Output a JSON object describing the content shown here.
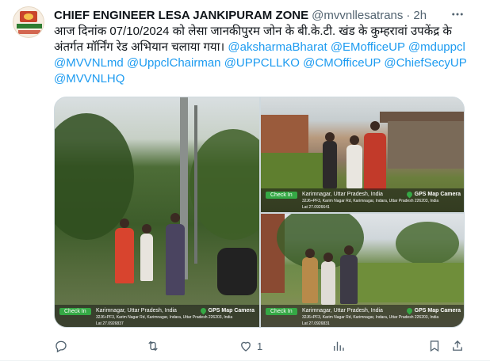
{
  "author": {
    "name": "CHIEF ENGINEER LESA JANKIPURAM ZONE",
    "handle": "@mvvnllesatrans",
    "time": "2h"
  },
  "tweet": {
    "text_hindi": "आज दिनांक 07/10/2024 को लेसा जानकीपुरम जोन के बी.के.टी. खंड के कुम्हरावां उपकेंद्र के अंतर्गत मॉर्निंग रेड अभियान चलाया गया।",
    "mentions": [
      "@aksharmaBharat",
      "@EMofficeUP",
      "@mduppcl",
      "@MVVNLmd",
      "@UppclChairman",
      "@UPPCLLKO",
      "@CMOfficeUP",
      "@ChiefSecyUP",
      "@MVVNLHQ"
    ]
  },
  "photos": [
    {
      "checkin": "Check In",
      "camera": "GPS Map Camera",
      "location": "Karimnagar, Uttar Pradesh, India",
      "address": "32J6+PF3, Karim Nagar Rd, Karimnagar, Indara, Uttar Pradesh 226203, India",
      "lat": "Lat 27.0926837"
    },
    {
      "checkin": "Check In",
      "camera": "GPS Map Camera",
      "location": "Karimnagar, Uttar Pradesh, India",
      "address": "32J6+PF3, Karim Nagar Rd, Karimnagar, Indara, Uttar Pradesh 226203, India",
      "lat": "Lat 27.0926641"
    },
    {
      "checkin": "Check In",
      "camera": "GPS Map Camera",
      "location": "Karimnagar, Uttar Pradesh, India",
      "address": "32J6+PF3, Karim Nagar Rd, Karimnagar, Indara, Uttar Pradesh 226203, India",
      "lat": "Lat 27.0926831"
    }
  ],
  "actions": {
    "reply_count": "",
    "retweet_count": "",
    "like_count": "1",
    "views_count": ""
  },
  "icons": [
    "more-icon",
    "reply-icon",
    "retweet-icon",
    "like-icon",
    "views-icon",
    "bookmark-icon",
    "share-icon"
  ],
  "colors": {
    "link": "#1d9bf0",
    "secondary": "#536471",
    "text": "#0f1419",
    "checkin": "#35a845"
  }
}
